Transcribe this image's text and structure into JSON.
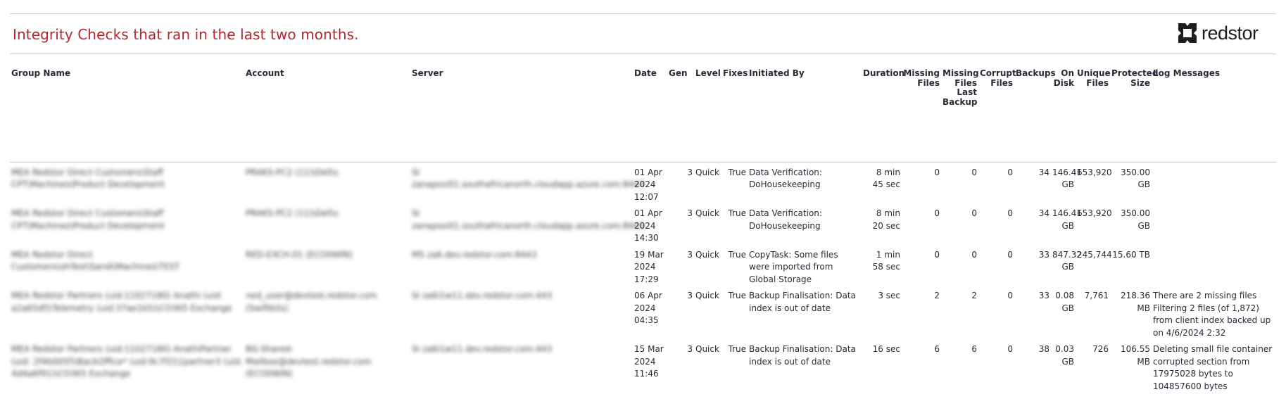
{
  "report": {
    "title": "Integrity Checks that ran in the last two months.",
    "brand": "redstor"
  },
  "table": {
    "headers": {
      "group": "Group Name",
      "account": "Account",
      "server": "Server",
      "date": "Date",
      "gen": "Gen",
      "level": "Level",
      "fixes": "Fixes",
      "initiated_by": "Initiated By",
      "duration": "Duration",
      "missing_files": "Missing Files",
      "missing_last_backup": "Missing Files Last Backup",
      "corrupt_files": "Corrupt Files",
      "backups": "Backups",
      "on_disk": "On Disk",
      "unique_files": "Unique Files",
      "protected_size": "Protected Size",
      "log_messages": "Log Messages"
    },
    "rows": [
      {
        "group": "MEA Redstor Direct Customers\\Staff CPT\\Machines\\Product Development",
        "account": "PRAKS-PC2 (11)\\Dell\\c",
        "server": "SI zanapssi01.southafricanorth.cloudapp.azure.com:8443",
        "date": "01 Apr 2024 12:07",
        "gen": "3",
        "level": "Quick",
        "fixes": "True",
        "initiated_by": "Data Verification: DoHousekeeping",
        "duration": "8 min 45 sec",
        "missing_files": "0",
        "missing_last_backup": "0",
        "corrupt_files": "0",
        "backups": "34",
        "on_disk": "146.41 GB",
        "unique_files": "653,920",
        "protected_size": "350.00 GB",
        "log_messages": ""
      },
      {
        "group": "MEA Redstor Direct Customers\\Staff CPT\\Machines\\Product Development",
        "account": "PRAKS-PC2 (11)\\Dell\\c",
        "server": "SI zanapssi01.southafricanorth.cloudapp.azure.com:8443",
        "date": "01 Apr 2024 14:30",
        "gen": "3",
        "level": "Quick",
        "fixes": "True",
        "initiated_by": "Data Verification: DoHousekeeping",
        "duration": "8 min 20 sec",
        "missing_files": "0",
        "missing_last_backup": "0",
        "corrupt_files": "0",
        "backups": "34",
        "on_disk": "146.41 GB",
        "unique_files": "653,920",
        "protected_size": "350.00 GB",
        "log_messages": ""
      },
      {
        "group": "MEA Redstor Direct Customers\\ohTest\\Sandi\\Machines\\TEST",
        "account": "RED-EXCH-01 (ECO0WIN)",
        "server": "MS za6.dev.redstor.com:8443",
        "date": "19 Mar 2024 17:29",
        "gen": "3",
        "level": "Quick",
        "fixes": "True",
        "initiated_by": "CopyTask: Some files were imported from Global Storage",
        "duration": "1 min 58 sec",
        "missing_files": "0",
        "missing_last_backup": "0",
        "corrupt_files": "0",
        "backups": "33",
        "on_disk": "847.32 GB",
        "unique_files": "245,744",
        "protected_size": "15.60 TB",
        "log_messages": ""
      },
      {
        "group": "MEA Redstor Partners (uid:11027180) Anathi (uid: a2a65df)\\Telemetry (uid:37ae1b5)\\CO365 Exchange",
        "account": "ned_user@devtest.redstor.com (Swiftbits)",
        "server": "SI za6i1w11.dev.redstor.com:443",
        "date": "06 Apr 2024 04:35",
        "gen": "3",
        "level": "Quick",
        "fixes": "True",
        "initiated_by": "Backup Finalisation: Data index is out of date",
        "duration": "3 sec",
        "missing_files": "2",
        "missing_last_backup": "2",
        "corrupt_files": "0",
        "backups": "33",
        "on_disk": "0.08 GB",
        "unique_files": "7,761",
        "protected_size": "218.36 MB",
        "log_messages": "There are 2 missing files Filtering 2 files (of 1,872) from client index backed up on 4/6/2024 2:32"
      },
      {
        "group": "MEA Redstor Partners (uid:11027180) AnathiPartner (uid: 2f4b005f)\\BackOffice* (uid:9c7f2)\\1partner3 (uid: 4d4a6f91)\\CO365 Exchange",
        "account": "BG-Shared-Mailbox@devtest.redstor.com (ECO0WIN)",
        "server": "SI za6i1w11.dev.redstor.com:443",
        "date": "15 Mar 2024 11:46",
        "gen": "3",
        "level": "Quick",
        "fixes": "True",
        "initiated_by": "Backup Finalisation: Data index is out of date",
        "duration": "16 sec",
        "missing_files": "6",
        "missing_last_backup": "6",
        "corrupt_files": "0",
        "backups": "38",
        "on_disk": "0.03 GB",
        "unique_files": "726",
        "protected_size": "106.55 MB",
        "log_messages": "Deleting small file container corrupted section from 17975028 bytes to 104857600 bytes"
      }
    ]
  }
}
